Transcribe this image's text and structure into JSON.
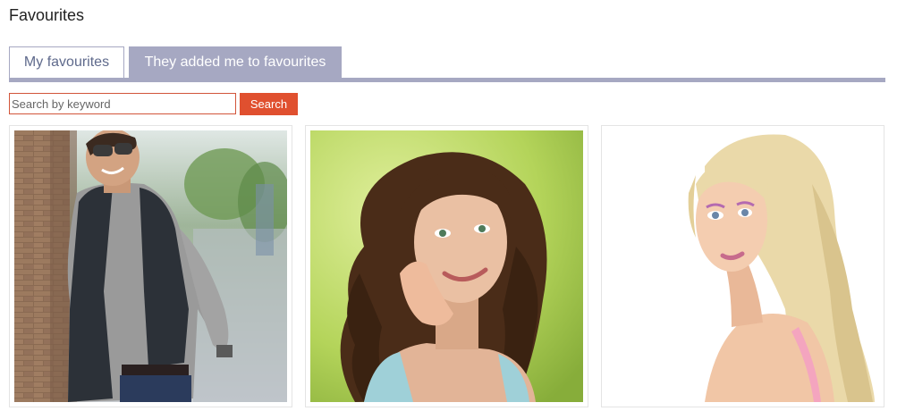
{
  "page": {
    "title": "Favourites"
  },
  "tabs": [
    {
      "label": "My favourites",
      "active": true
    },
    {
      "label": "They added me to favourites",
      "active": false
    }
  ],
  "search": {
    "placeholder": "Search by keyword",
    "value": "",
    "button_label": "Search"
  },
  "colors": {
    "tab_accent": "#a6a8c2",
    "active_tab_text": "#5f6a8c",
    "search_button": "#e0502f",
    "search_border": "#d2553a"
  },
  "favourites": [
    {
      "photo": "man-leaning-against-brick-wall-photo"
    },
    {
      "photo": "curly-haired-woman-smiling-photo"
    },
    {
      "photo": "blonde-woman-portrait-photo"
    }
  ]
}
